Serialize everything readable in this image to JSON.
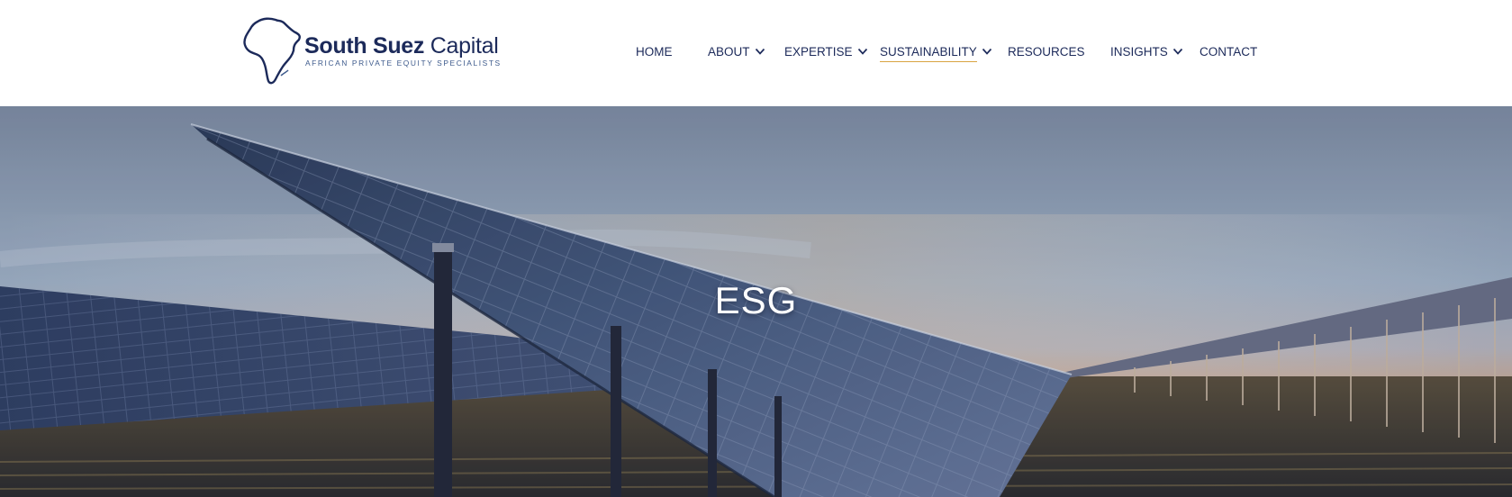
{
  "header": {
    "logo": {
      "name_bold": "South Suez",
      "name_light": "Capital",
      "tagline": "AFRICAN PRIVATE EQUITY SPECIALISTS"
    },
    "nav": [
      {
        "label": "HOME",
        "has_dropdown": false,
        "active": false
      },
      {
        "label": "ABOUT",
        "has_dropdown": true,
        "active": false
      },
      {
        "label": "EXPERTISE",
        "has_dropdown": true,
        "active": false
      },
      {
        "label": "SUSTAINABILITY",
        "has_dropdown": true,
        "active": true
      },
      {
        "label": "RESOURCES",
        "has_dropdown": false,
        "active": false
      },
      {
        "label": "INSIGHTS",
        "has_dropdown": true,
        "active": false
      },
      {
        "label": "CONTACT",
        "has_dropdown": false,
        "active": false
      }
    ]
  },
  "hero": {
    "title": "ESG",
    "image": "solar-panel-field-at-dusk"
  },
  "colors": {
    "brand_navy": "#1c2a5a",
    "accent_underline": "#d9a441",
    "tagline_blue": "#3d5a8c"
  }
}
